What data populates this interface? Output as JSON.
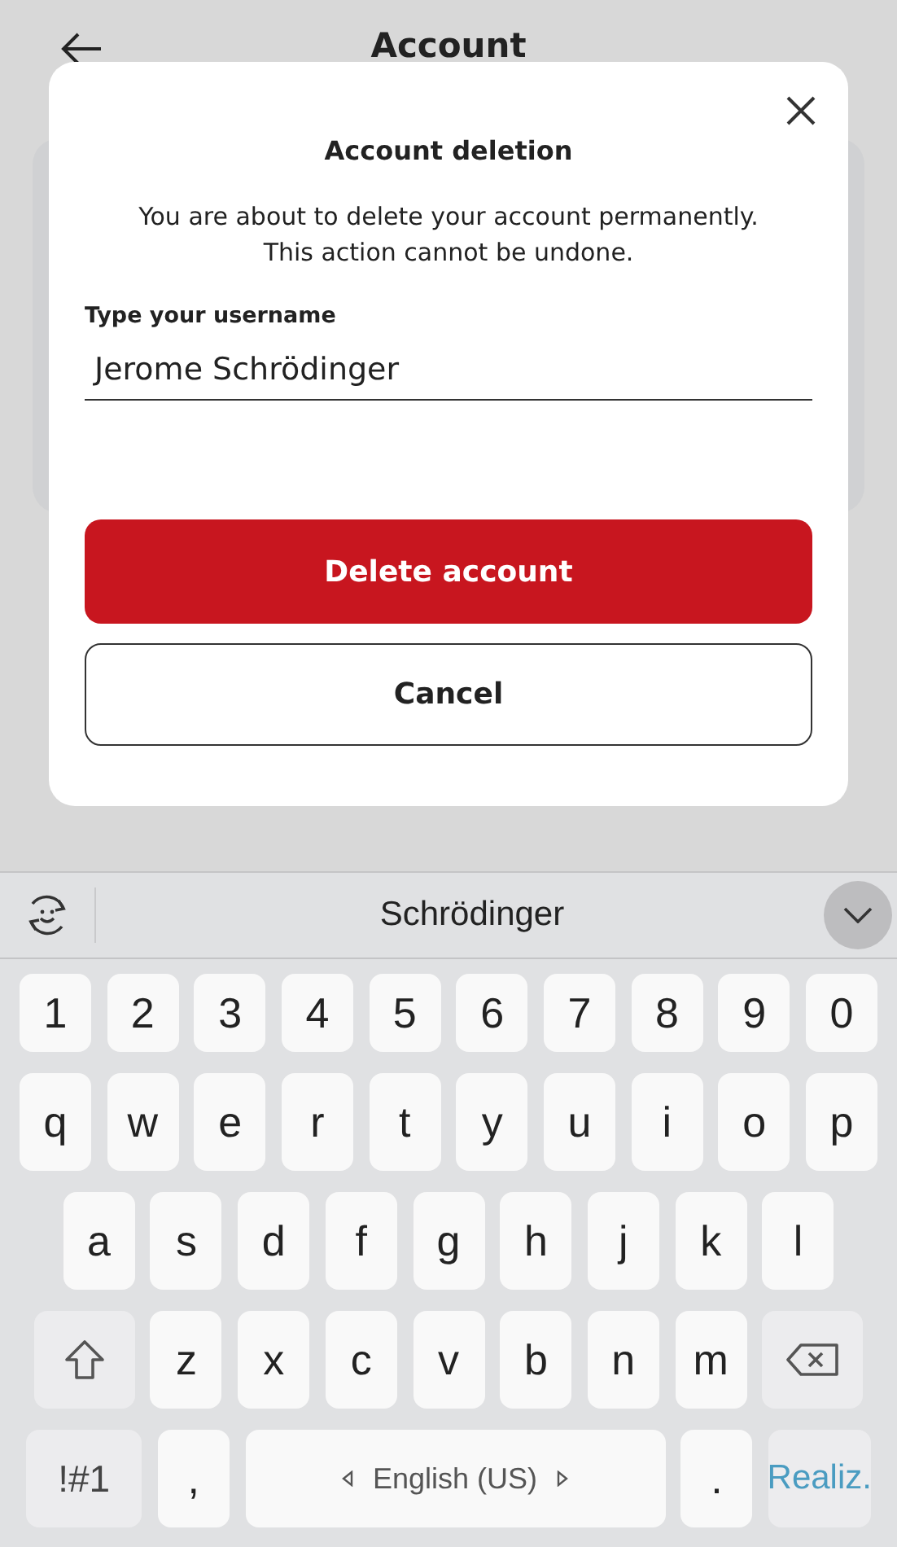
{
  "app_bar": {
    "title": "Account"
  },
  "dialog": {
    "title": "Account deletion",
    "message": "You are about to delete your account permanently.\nThis action cannot be undone.",
    "field": {
      "label": "Type your username",
      "value": "Jerome Schrödinger"
    },
    "buttons": [
      {
        "label": "Delete account",
        "kind": "primary"
      },
      {
        "label": "Cancel",
        "kind": "secondary"
      }
    ]
  },
  "keyboard": {
    "suggestion": "Schrödinger",
    "rows": [
      {
        "keys": [
          {
            "label": "1",
            "kind": "num"
          },
          {
            "label": "2",
            "kind": "num"
          },
          {
            "label": "3",
            "kind": "num"
          },
          {
            "label": "4",
            "kind": "num"
          },
          {
            "label": "5",
            "kind": "num"
          },
          {
            "label": "6",
            "kind": "num"
          },
          {
            "label": "7",
            "kind": "num"
          },
          {
            "label": "8",
            "kind": "num"
          },
          {
            "label": "9",
            "kind": "num"
          },
          {
            "label": "0",
            "kind": "num"
          }
        ]
      },
      {
        "keys": [
          {
            "label": "q",
            "kind": "char"
          },
          {
            "label": "w",
            "kind": "char"
          },
          {
            "label": "e",
            "kind": "char"
          },
          {
            "label": "r",
            "kind": "char"
          },
          {
            "label": "t",
            "kind": "char"
          },
          {
            "label": "y",
            "kind": "char"
          },
          {
            "label": "u",
            "kind": "char"
          },
          {
            "label": "i",
            "kind": "char"
          },
          {
            "label": "o",
            "kind": "char"
          },
          {
            "label": "p",
            "kind": "char"
          }
        ]
      },
      {
        "keys": [
          {
            "label": "a",
            "kind": "char"
          },
          {
            "label": "s",
            "kind": "char"
          },
          {
            "label": "d",
            "kind": "char"
          },
          {
            "label": "f",
            "kind": "char"
          },
          {
            "label": "g",
            "kind": "char"
          },
          {
            "label": "h",
            "kind": "char"
          },
          {
            "label": "j",
            "kind": "char"
          },
          {
            "label": "k",
            "kind": "char"
          },
          {
            "label": "l",
            "kind": "char"
          }
        ]
      },
      {
        "keys": [
          {
            "kind": "shift"
          },
          {
            "label": "z",
            "kind": "char"
          },
          {
            "label": "x",
            "kind": "char"
          },
          {
            "label": "c",
            "kind": "char"
          },
          {
            "label": "v",
            "kind": "char"
          },
          {
            "label": "b",
            "kind": "char"
          },
          {
            "label": "n",
            "kind": "char"
          },
          {
            "label": "m",
            "kind": "char"
          },
          {
            "kind": "backspace"
          }
        ]
      },
      {
        "keys": [
          {
            "label": "!#1",
            "kind": "symbols"
          },
          {
            "label": ",",
            "kind": "char"
          },
          {
            "label": "English (US)",
            "kind": "space"
          },
          {
            "label": ".",
            "kind": "char"
          },
          {
            "label": "Realiz.",
            "kind": "enter"
          }
        ]
      }
    ]
  }
}
